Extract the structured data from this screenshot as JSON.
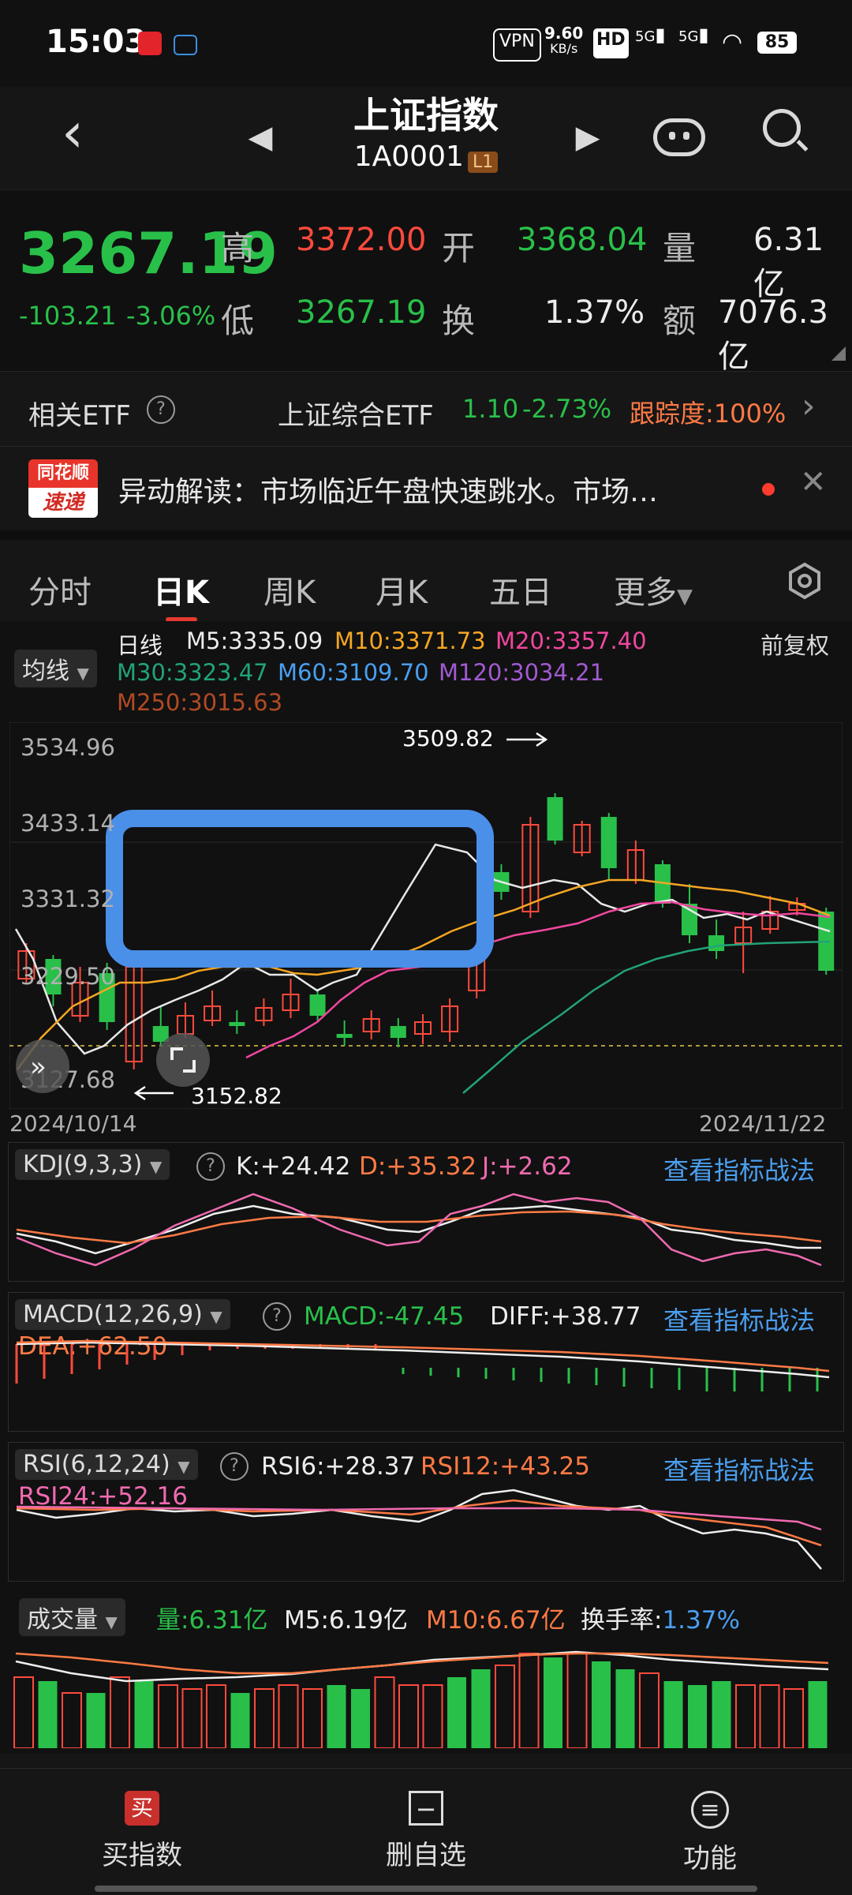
{
  "status_bar": {
    "time": "15:03",
    "net_speed": "9.60",
    "net_unit": "KB/s",
    "vpn": "VPN",
    "hd": "HD",
    "sig1": "5G",
    "sig2": "5G",
    "battery": "85"
  },
  "header": {
    "title": "上证指数",
    "code": "1A0001",
    "level_badge": "L1"
  },
  "quote": {
    "price": "3267.19",
    "change": "-103.21",
    "change_pct": "-3.06%",
    "high_label": "高",
    "high": "3372.00",
    "open_label": "开",
    "open": "3368.04",
    "vol_label": "量",
    "vol": "6.31亿",
    "low_label": "低",
    "low": "3267.19",
    "turnover_label": "换",
    "turnover": "1.37%",
    "amount_label": "额",
    "amount": "7076.3亿"
  },
  "etf": {
    "label": "相关ETF",
    "name": "上证综合ETF",
    "price": "1.10",
    "change": "-2.73%",
    "track": "跟踪度:100%"
  },
  "news": {
    "logo_top": "同花顺",
    "logo_bottom": "速递",
    "text": "异动解读：市场临近午盘快速跳水。市场…"
  },
  "tabs": [
    "分时",
    "日K",
    "周K",
    "月K",
    "五日",
    "更多"
  ],
  "ma_legend": {
    "period": "日线",
    "ma_button": "均线",
    "adjust": "前复权",
    "m5": "M5:3335.09",
    "m10": "M10:3371.73",
    "m20": "M20:3357.40",
    "m30": "M30:3323.47",
    "m60": "M60:3109.70",
    "m120": "M120:3034.21",
    "m250": "M250:3015.63"
  },
  "chart": {
    "price_ticks": [
      "3534.96",
      "3433.14",
      "3331.32",
      "3229.50",
      "3127.68"
    ],
    "max_label": "3509.82",
    "min_label": "3152.82",
    "start_date": "2024/10/14",
    "end_date": "2024/11/22"
  },
  "kdj": {
    "name": "KDJ(9,3,3)",
    "k": "K:+24.42",
    "d": "D:+35.32",
    "j": "J:+2.62",
    "link": "查看指标战法"
  },
  "macd": {
    "name": "MACD(12,26,9)",
    "macd": "MACD:-47.45",
    "diff": "DIFF:+38.77",
    "dea": "DEA:+62.50",
    "link": "查看指标战法"
  },
  "rsi": {
    "name": "RSI(6,12,24)",
    "rsi6": "RSI6:+28.37",
    "rsi12": "RSI12:+43.25",
    "rsi24": "RSI24:+52.16",
    "link": "查看指标战法"
  },
  "volume": {
    "name": "成交量",
    "vol": "量:6.31亿",
    "m5": "M5:6.19亿",
    "m10": "M10:6.67亿",
    "turnover_label": "换手率:",
    "turnover": "1.37%"
  },
  "bottom_nav": [
    {
      "label": "买指数",
      "icon": "买"
    },
    {
      "label": "删自选",
      "icon": "−"
    },
    {
      "label": "功能",
      "icon": "≡"
    }
  ],
  "colors": {
    "up": "#ff4a3d",
    "down": "#29c04a",
    "highlight": "#4a8fe8"
  }
}
